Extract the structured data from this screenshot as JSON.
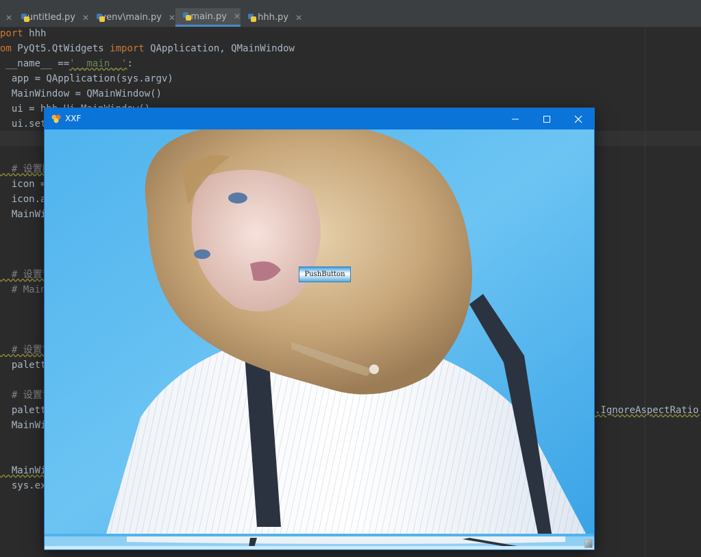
{
  "ide": {
    "tabs": [
      {
        "label": "",
        "close": "✕"
      },
      {
        "label": "untitled.py",
        "close": "✕"
      },
      {
        "label": "venv\\main.py",
        "close": "✕"
      },
      {
        "label": "main.py",
        "close": "✕"
      },
      {
        "label": "hhh.py",
        "close": "✕"
      }
    ],
    "code": {
      "line1_kw": "port",
      "line1_rest": " hhh",
      "line2_kw": "om",
      "line2_mid": " PyQt5.QtWidgets ",
      "line2_kw2": "import",
      "line2_rest": " QApplication, QMainWindow",
      "line3_pre": " __name__ ==",
      "line3_str": "'__main__'",
      "line3_post": ":",
      "line4": "  app = QApplication(sys.argv)",
      "line5": "  MainWindow = QMainWindow()",
      "line6": "  ui = hhh.Ui_MainWindow()",
      "line7": "  ui.setu",
      "line8": "  # 设置图",
      "line9": "  icon = ",
      "line10": "  icon.ad",
      "line11": "  MainWin",
      "line12": "  # 设置背",
      "line13": "  # MainW",
      "line14": "  # 设置背",
      "line15": "  palette",
      "line16": "  # 设置背",
      "line17": "  palette",
      "line17_tail": ".IgnoreAspectRatio,",
      "line18": "  MainWin",
      "line19": "  MainWin",
      "line20": "  sys.exi"
    }
  },
  "window": {
    "title": "XXF",
    "minimize_glyph": "—",
    "maximize_glyph": "☐",
    "close_glyph": "✕",
    "push_button_label": "PushButton"
  }
}
